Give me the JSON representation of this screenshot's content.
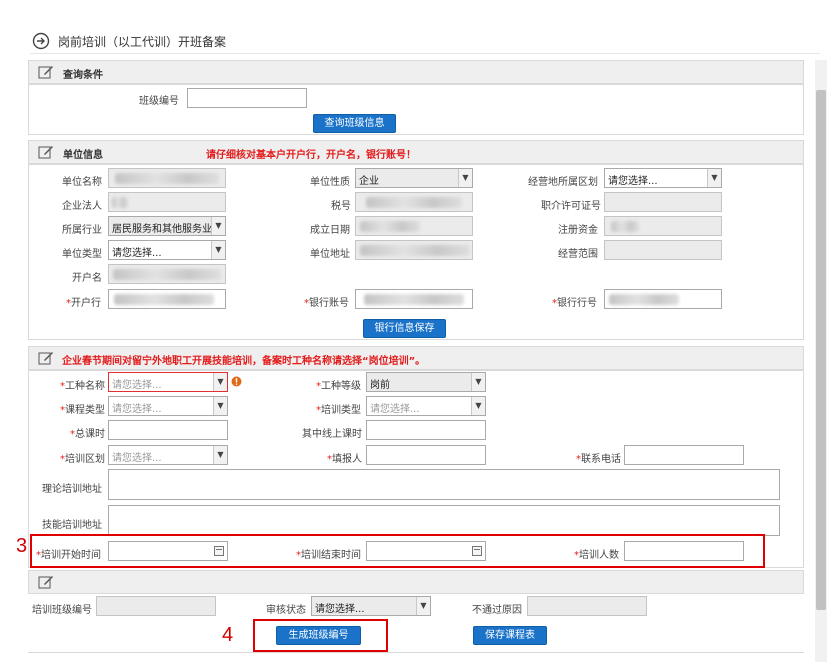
{
  "page": {
    "title": "岗前培训（以工代训）开班备案"
  },
  "query": {
    "header": "查询条件",
    "class_no_label": "班级编号",
    "class_no_value": "",
    "search_button": "查询班级信息"
  },
  "unit": {
    "header": "单位信息",
    "warning": "请仔细核对基本户开户行，开户名，银行账号！",
    "name_label": "单位名称",
    "nature_label": "单位性质",
    "nature_value": "企业",
    "district_label": "经营地所属区划",
    "district_value": "请您选择...",
    "legal_label": "企业法人",
    "tax_label": "税号",
    "license_label": "职介许可证号",
    "industry_label": "所属行业",
    "industry_value": "居民服务和其他服务业",
    "founded_label": "成立日期",
    "capital_label": "注册资金",
    "type_label": "单位类型",
    "type_value": "请您选择...",
    "address_label": "单位地址",
    "scope_label": "经营范围",
    "account_name_label": "开户名",
    "bank_label": "开户行",
    "account_no_label": "银行账号",
    "bank_code_label": "银行行号",
    "save_button": "银行信息保存"
  },
  "training": {
    "warning": "企业春节期间对留宁外地职工开展技能培训，备案时工种名称请选择“岗位培训”。",
    "job_name_label": "工种名称",
    "job_name_placeholder": "请您选择...",
    "job_level_label": "工种等级",
    "job_level_value": "岗前",
    "course_type_label": "课程类型",
    "course_type_placeholder": "请您选择...",
    "train_type_label": "培训类型",
    "train_type_placeholder": "请您选择...",
    "total_hours_label": "总课时",
    "online_hours_label": "其中线上课时",
    "train_district_label": "培训区划",
    "train_district_placeholder": "请您选择...",
    "reporter_label": "填报人",
    "phone_label": "联系电话",
    "theory_address_label": "理论培训地址",
    "skill_address_label": "技能培训地址",
    "start_label": "培训开始时间",
    "end_label": "培训结束时间",
    "count_label": "培训人数",
    "required_mark": "*"
  },
  "bottom": {
    "class_no_label": "培训班级编号",
    "audit_label": "审核状态",
    "audit_value": "请您选择...",
    "reason_label": "不通过原因",
    "generate_button": "生成班级编号",
    "save_button": "保存课程表"
  },
  "annotations": {
    "step3": "3",
    "step4": "4"
  },
  "colors": {
    "accent_blue": "#1a73c9",
    "warning_red": "#e31b1b",
    "annotation_red": "#e00000"
  }
}
